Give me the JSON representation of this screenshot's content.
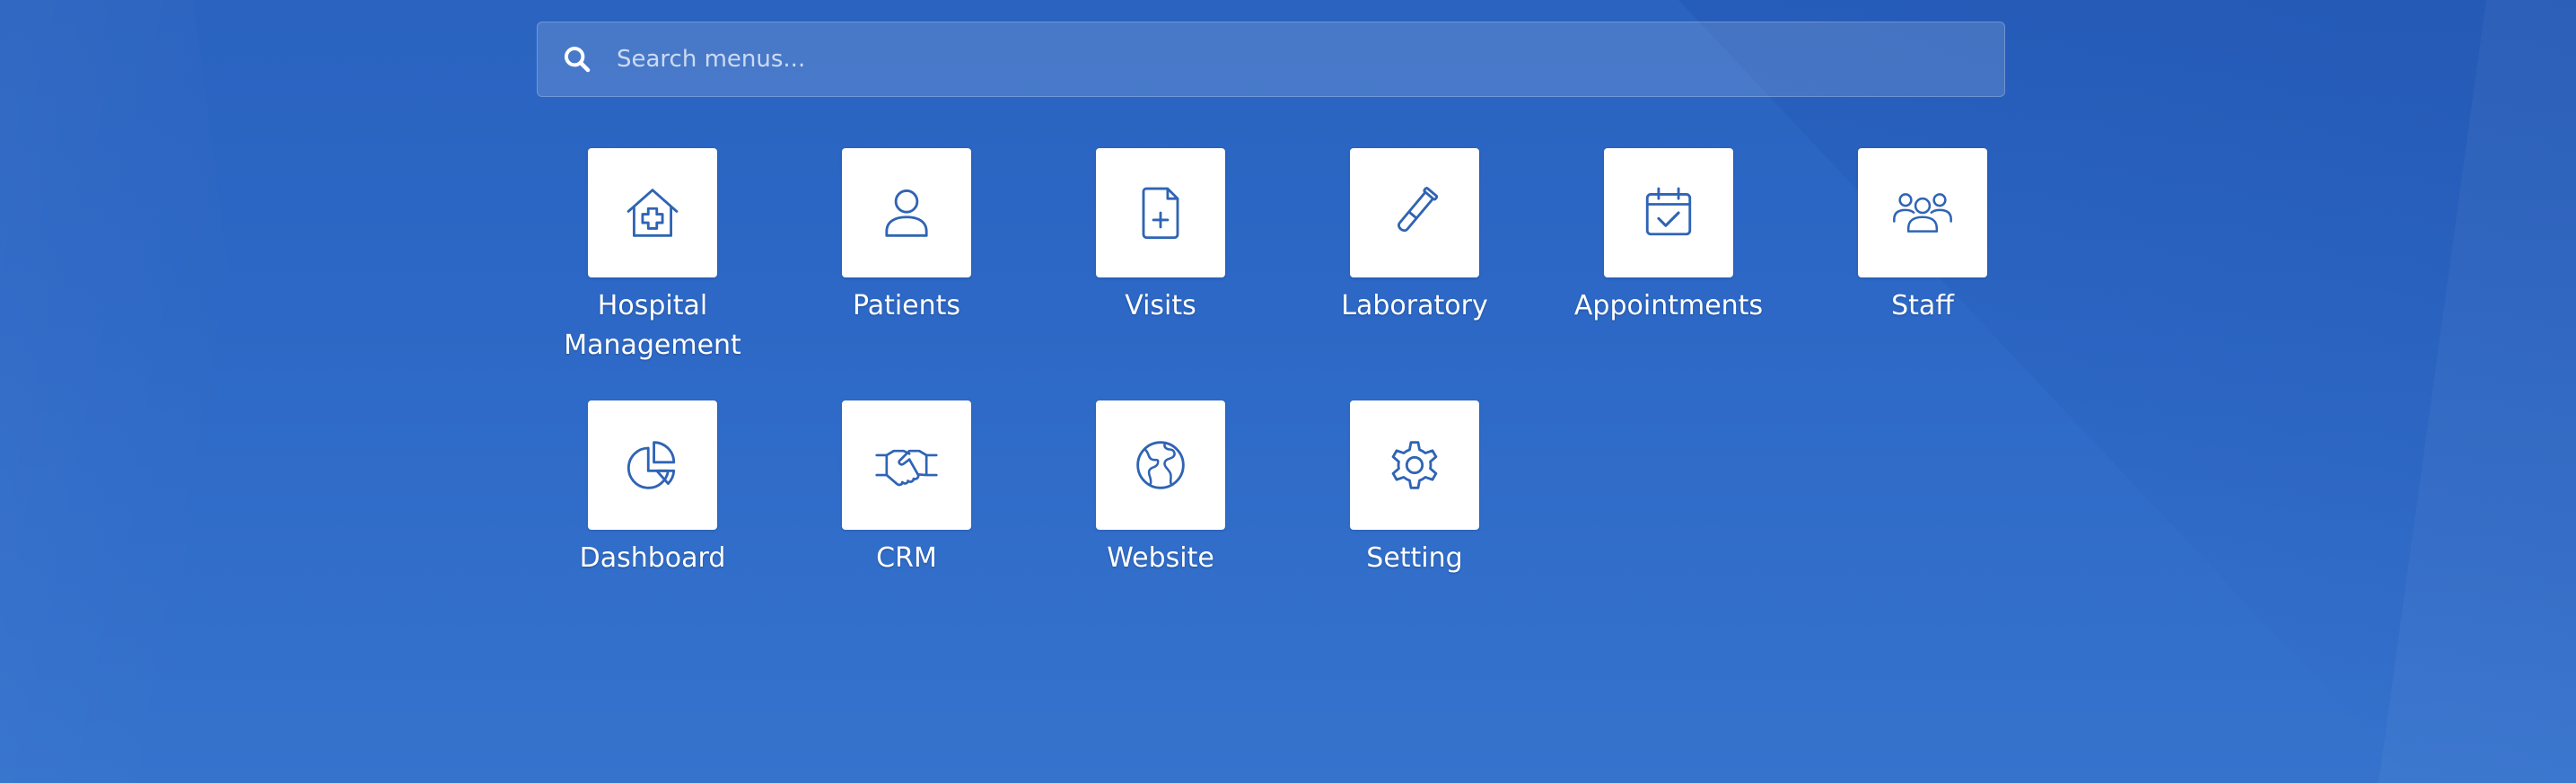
{
  "search": {
    "placeholder": "Search menus..."
  },
  "apps": [
    {
      "label_line1": "Hospital",
      "label_line2": "Management",
      "icon": "hospital-icon"
    },
    {
      "label": "Patients",
      "icon": "user-icon"
    },
    {
      "label": "Visits",
      "icon": "medical-file-icon"
    },
    {
      "label": "Laboratory",
      "icon": "test-tube-icon"
    },
    {
      "label": "Appointments",
      "icon": "calendar-check-icon"
    },
    {
      "label": "Staff",
      "icon": "users-group-icon"
    },
    {
      "label": "Dashboard",
      "icon": "pie-chart-icon"
    },
    {
      "label": "CRM",
      "icon": "handshake-icon"
    },
    {
      "label": "Website",
      "icon": "globe-icon"
    },
    {
      "label": "Setting",
      "icon": "gear-icon"
    }
  ],
  "colors": {
    "background": "#2d68c6",
    "tile": "#ffffff",
    "icon_stroke": "#2f64b4"
  }
}
